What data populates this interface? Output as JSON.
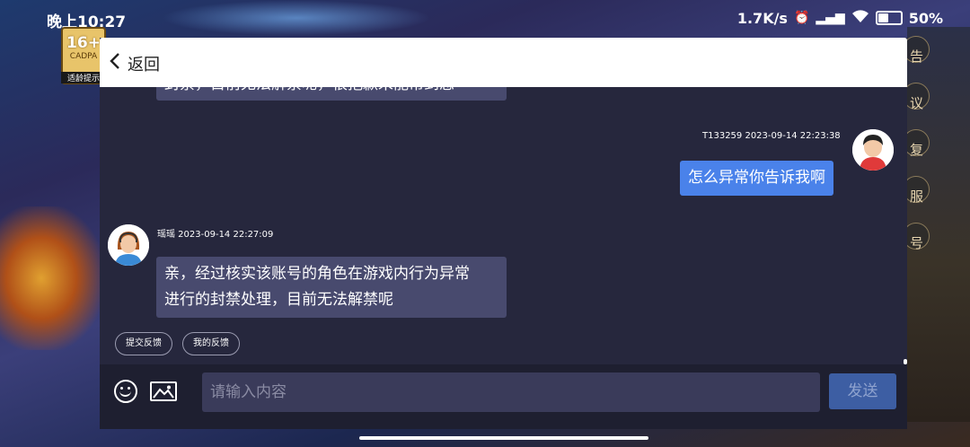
{
  "status_bar": {
    "time": "晚上10:27",
    "net_speed": "1.7K/s",
    "battery": "50%"
  },
  "game": {
    "age_rating": "16+",
    "age_sub": "CADPA",
    "age_tip": "适龄提示",
    "side_menu": [
      "告",
      "议",
      "复",
      "服",
      "号"
    ]
  },
  "header": {
    "back_label": "返回"
  },
  "chat": {
    "prev_agent_fragment": "封禁，目前无法解禁呢，很抱歉未能帮到您",
    "user_meta": "T133259  2023-09-14 22:23:38",
    "user_message": "怎么异常你告诉我啊",
    "agent_meta": "瑶瑶  2023-09-14 22:27:09",
    "agent_message_line1": "亲，经过核实该账号的角色在游戏内行为异常",
    "agent_message_line2": "进行的封禁处理，目前无法解禁呢"
  },
  "chips": {
    "submit_feedback": "提交反馈",
    "my_feedback": "我的反馈"
  },
  "input": {
    "placeholder": "请输入内容",
    "send_label": "发送"
  }
}
